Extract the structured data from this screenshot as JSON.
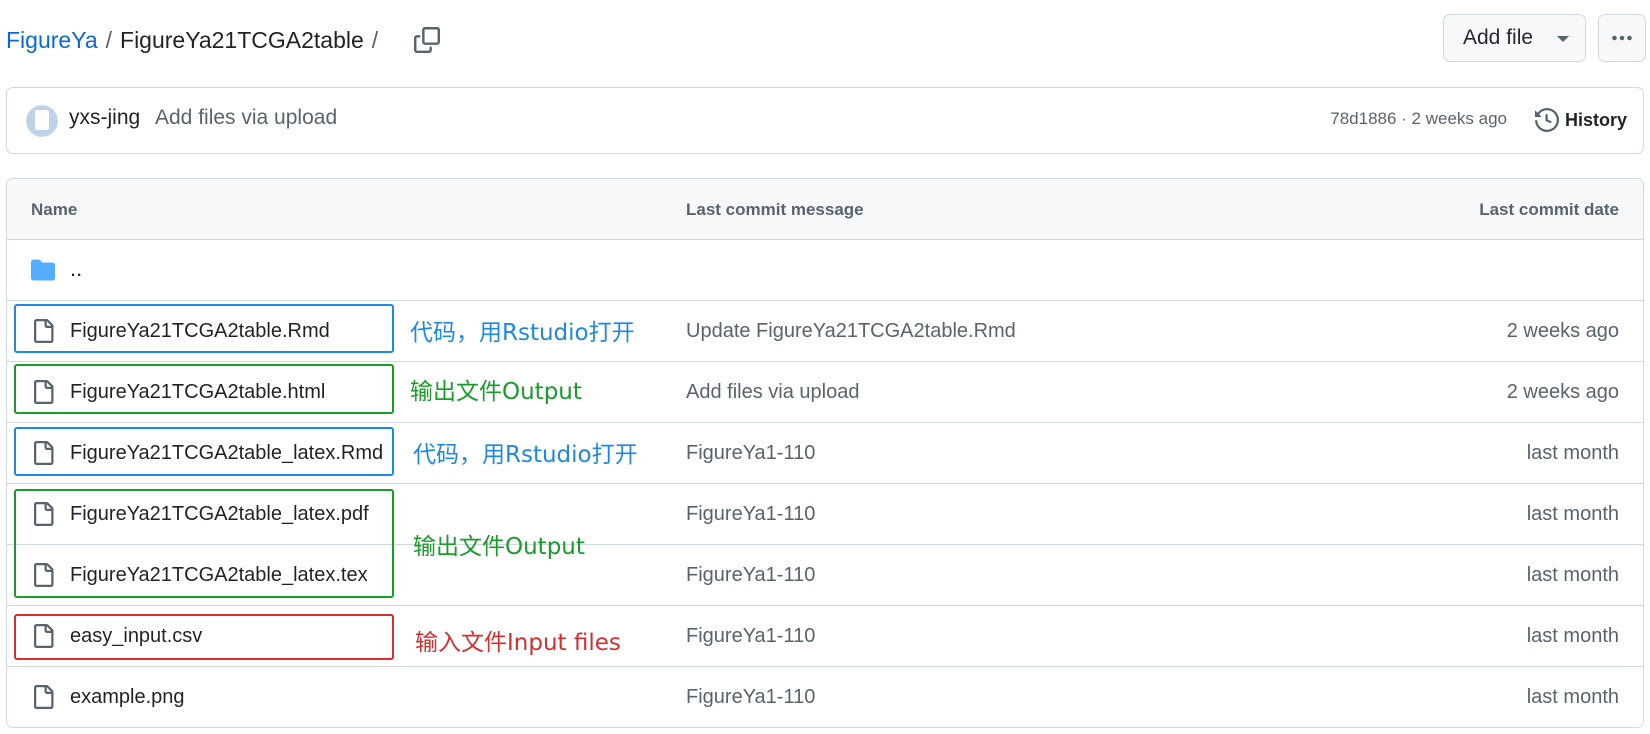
{
  "breadcrumb": {
    "repo": "FigureYa",
    "folder": "FigureYa21TCGA2table",
    "separator": "/"
  },
  "actions": {
    "add_file_label": "Add file"
  },
  "commit": {
    "author": "yxs-jing",
    "message": "Add files via upload",
    "meta": "78d1886 · 2 weeks ago",
    "history_label": "History"
  },
  "table": {
    "headers": {
      "name": "Name",
      "message": "Last commit message",
      "date": "Last commit date"
    },
    "parent_label": "..",
    "rows": [
      {
        "name": "FigureYa21TCGA2table.Rmd",
        "message": "Update FigureYa21TCGA2table.Rmd",
        "date": "2 weeks ago"
      },
      {
        "name": "FigureYa21TCGA2table.html",
        "message": "Add files via upload",
        "date": "2 weeks ago"
      },
      {
        "name": "FigureYa21TCGA2table_latex.Rmd",
        "message": "FigureYa1-110",
        "date": "last month"
      },
      {
        "name": "FigureYa21TCGA2table_latex.pdf",
        "message": "FigureYa1-110",
        "date": "last month"
      },
      {
        "name": "FigureYa21TCGA2table_latex.tex",
        "message": "FigureYa1-110",
        "date": "last month"
      },
      {
        "name": "easy_input.csv",
        "message": "FigureYa1-110",
        "date": "last month"
      },
      {
        "name": "example.png",
        "message": "FigureYa1-110",
        "date": "last month"
      }
    ]
  },
  "annotations": [
    {
      "text": "代码，用Rstudio打开",
      "color": "#1e88e5"
    },
    {
      "text": "输出文件Output",
      "color": "#1a9c2a"
    },
    {
      "text": "代码，用Rstudio打开",
      "color": "#1e88e5"
    },
    {
      "text": "输出文件Output",
      "color": "#1a9c2a"
    },
    {
      "text": "输入文件Input files",
      "color": "#d32f2f"
    }
  ],
  "colors": {
    "link_blue": "#0969da",
    "folder_blue": "#54aeff",
    "border": "#d1d9e0",
    "muted_text": "#59636e",
    "header_bg": "#f6f8fa"
  },
  "icons": {
    "copy": "copy-icon",
    "caret": "triangle-down-icon",
    "more": "kebab-horizontal-icon",
    "history": "history-icon",
    "folder": "folder-icon",
    "file": "file-icon"
  }
}
